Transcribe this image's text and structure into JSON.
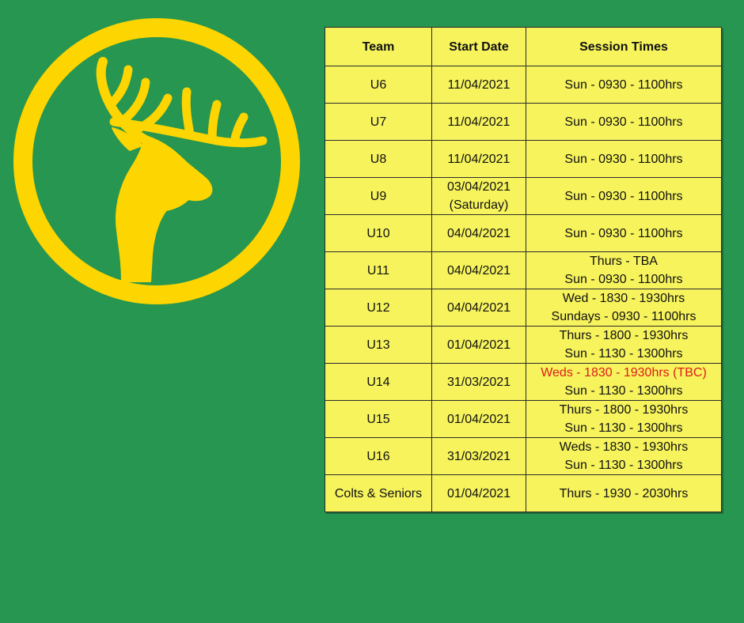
{
  "logo": {
    "name": "club-stag-logo",
    "colors": {
      "ring": "#fdd500",
      "stag": "#fdd500",
      "background": "#279650"
    }
  },
  "table": {
    "headers": [
      "Team",
      "Start Date",
      "Session Times"
    ],
    "rows": [
      {
        "team": "U6",
        "start": [
          "11/04/2021"
        ],
        "sessions": [
          "Sun - 0930 - 1100hrs"
        ]
      },
      {
        "team": "U7",
        "start": [
          "11/04/2021"
        ],
        "sessions": [
          "Sun - 0930 - 1100hrs"
        ]
      },
      {
        "team": "U8",
        "start": [
          "11/04/2021"
        ],
        "sessions": [
          "Sun - 0930 - 1100hrs"
        ]
      },
      {
        "team": "U9",
        "start": [
          "03/04/2021",
          "(Saturday)"
        ],
        "sessions": [
          "Sun - 0930 - 1100hrs"
        ]
      },
      {
        "team": "U10",
        "start": [
          "04/04/2021"
        ],
        "sessions": [
          "Sun - 0930 - 1100hrs"
        ]
      },
      {
        "team": "U11",
        "start": [
          "04/04/2021"
        ],
        "sessions": [
          "Thurs - TBA",
          "Sun - 0930 - 1100hrs"
        ]
      },
      {
        "team": "U12",
        "start": [
          "04/04/2021"
        ],
        "sessions": [
          "Wed - 1830 - 1930hrs",
          "Sundays - 0930 - 1100hrs"
        ]
      },
      {
        "team": "U13",
        "start": [
          "01/04/2021"
        ],
        "sessions": [
          "Thurs - 1800 - 1930hrs",
          "Sun - 1130 - 1300hrs"
        ]
      },
      {
        "team": "U14",
        "start": [
          "31/03/2021"
        ],
        "sessions": [
          "Weds - 1830 - 1930hrs (TBC)",
          "Sun - 1130 - 1300hrs"
        ],
        "highlight_first": true
      },
      {
        "team": "U15",
        "start": [
          "01/04/2021"
        ],
        "sessions": [
          "Thurs - 1800 - 1930hrs",
          "Sun - 1130 - 1300hrs"
        ]
      },
      {
        "team": "U16",
        "start": [
          "31/03/2021"
        ],
        "sessions": [
          "Weds - 1830 - 1930hrs",
          "Sun - 1130 - 1300hrs"
        ]
      },
      {
        "team": "Colts & Seniors",
        "start": [
          "01/04/2021"
        ],
        "sessions": [
          "Thurs - 1930 - 2030hrs"
        ]
      }
    ],
    "colors": {
      "cell_bg": "#f6f35d",
      "highlight_text": "#e01b1b",
      "border": "#2b2b2b"
    }
  }
}
